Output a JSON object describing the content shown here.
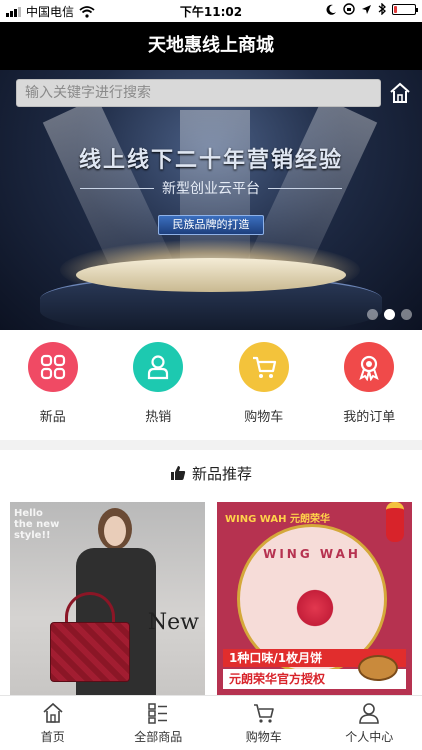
{
  "status_bar": {
    "carrier": "中国电信",
    "time": "下午11:02",
    "battery_level": 0.15,
    "battery_color": "#e23b3b"
  },
  "header": {
    "title": "天地惠线上商城"
  },
  "search": {
    "placeholder": "输入关键字进行搜索",
    "value": ""
  },
  "banner": {
    "headline": "线上线下二十年营销经验",
    "subtitle": "新型创业云平台",
    "badge": "民族品牌的打造",
    "slide_count": 3,
    "active_slide": 1
  },
  "quick_nav": [
    {
      "label": "新品",
      "icon": "grid-icon",
      "color": "#f04a64"
    },
    {
      "label": "热销",
      "icon": "user-icon",
      "color": "#1dc9b0"
    },
    {
      "label": "购物车",
      "icon": "cart-icon",
      "color": "#f3c33b"
    },
    {
      "label": "我的订单",
      "icon": "award-icon",
      "color": "#f04a4a"
    }
  ],
  "section": {
    "title": "新品推荐",
    "icon": "thumbs-up-icon"
  },
  "products": [
    {
      "slogan": "Hello the new style!!",
      "mark": "New"
    },
    {
      "brand": "WING WAH 元朗荣华",
      "seal": "WING WAH",
      "tag1": "1种口味/1枚月饼",
      "tag2": "元朗荣华官方授权"
    }
  ],
  "tab_bar": [
    {
      "label": "首页",
      "icon": "home-icon"
    },
    {
      "label": "全部商品",
      "icon": "list-icon"
    },
    {
      "label": "购物车",
      "icon": "cart-icon"
    },
    {
      "label": "个人中心",
      "icon": "person-icon"
    }
  ]
}
